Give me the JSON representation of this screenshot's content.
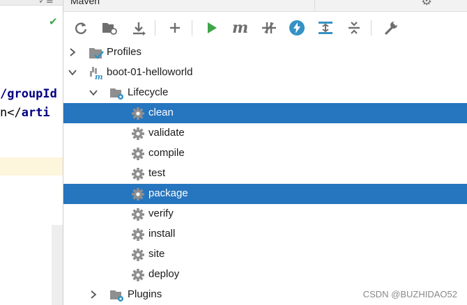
{
  "editor": {
    "top_glyph": "✓≡",
    "check_mark": "✔",
    "line1_text": "/groupId",
    "line2_text": "n</",
    "line2_tag": "arti"
  },
  "panel": {
    "title": "Maven",
    "toolbar": [
      {
        "icon": "reload-icon",
        "tooltip": ""
      },
      {
        "icon": "folder-reload-icon",
        "tooltip": ""
      },
      {
        "icon": "download-icon",
        "tooltip": ""
      },
      {
        "icon": "plus-icon",
        "tooltip": ""
      },
      {
        "icon": "run-icon",
        "tooltip": ""
      },
      {
        "icon": "maven-goal-icon",
        "tooltip": ""
      },
      {
        "icon": "skip-tests-icon",
        "tooltip": ""
      },
      {
        "icon": "offline-icon",
        "tooltip": ""
      },
      {
        "icon": "show-dependencies-icon",
        "tooltip": ""
      },
      {
        "icon": "collapse-all-icon",
        "tooltip": ""
      },
      {
        "icon": "settings-wrench-icon",
        "tooltip": ""
      }
    ]
  },
  "tree": {
    "profiles": "Profiles",
    "project": "boot-01-helloworld",
    "lifecycle": "Lifecycle",
    "phases": [
      "clean",
      "validate",
      "compile",
      "test",
      "package",
      "verify",
      "install",
      "site",
      "deploy"
    ],
    "plugins": "Plugins"
  },
  "colors": {
    "selection": "#2675bf",
    "run_green": "#3fa54a",
    "offline_blue": "#3592c4"
  },
  "watermark": "CSDN @BUZHIDAO52"
}
